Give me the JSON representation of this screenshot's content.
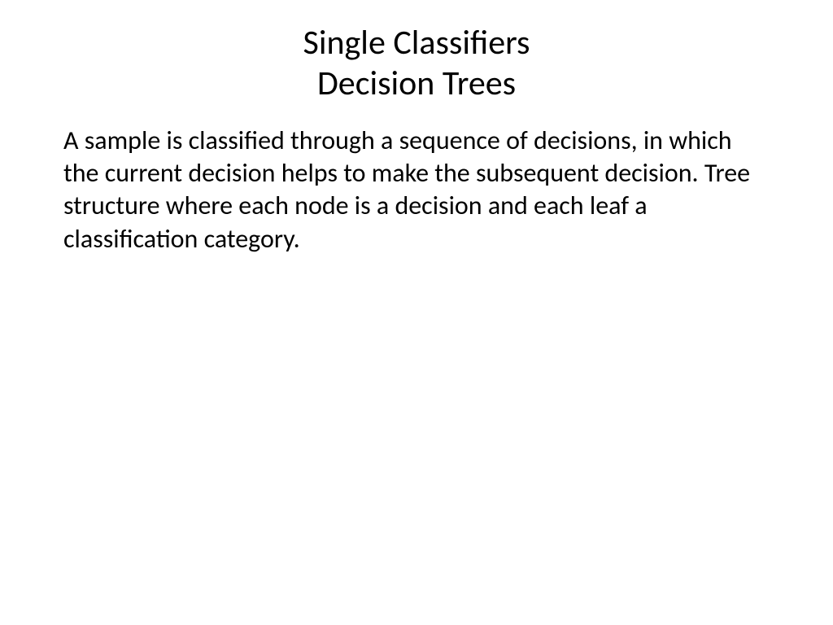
{
  "slide": {
    "title_line1": "Single Classifiers",
    "title_line2": "Decision Trees",
    "body": "A sample is classified through a sequence of decisions, in which the current decision helps to make the subsequent decision. Tree structure where each node is a decision and each leaf a classification category."
  }
}
